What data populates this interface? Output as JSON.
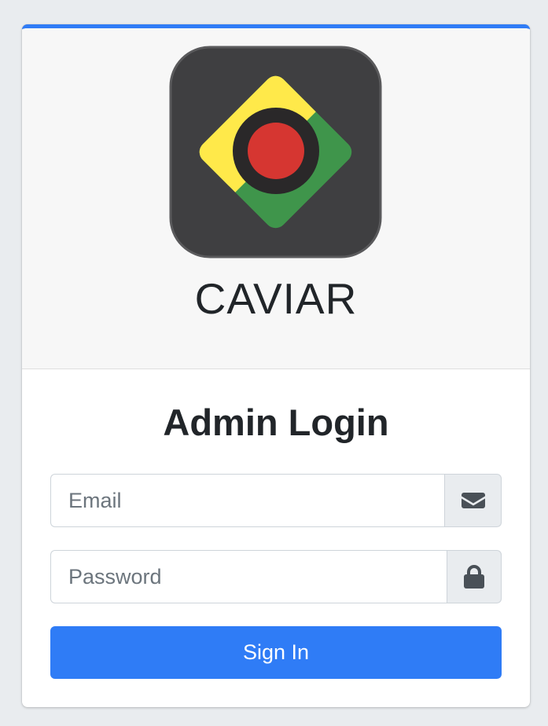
{
  "colors": {
    "accent": "#2f7cf6",
    "logo_background": "#3f3f41",
    "logo_yellow": "#ffe94a",
    "logo_green": "#3f954b",
    "logo_red": "#d63631"
  },
  "header": {
    "logo_icon": "caviar-logo",
    "brand": "CAVIAR"
  },
  "form": {
    "title": "Admin Login",
    "email": {
      "placeholder": "Email",
      "value": "",
      "icon": "envelope-icon"
    },
    "password": {
      "placeholder": "Password",
      "value": "",
      "icon": "lock-icon"
    },
    "submit_label": "Sign In"
  }
}
